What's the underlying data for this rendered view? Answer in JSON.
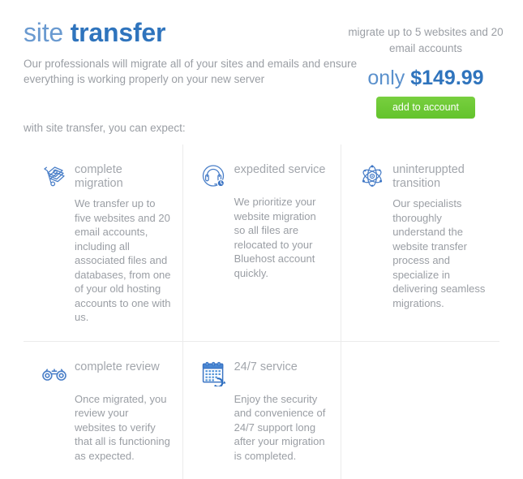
{
  "header": {
    "title_light": "site",
    "title_bold": "transfer",
    "subhead": "Our professionals will migrate all of your sites and emails and ensure everything is working properly on your new server",
    "offer_text": "migrate up to 5 websites and 20 email accounts",
    "price_prefix": "only",
    "price_amount": "$149.99",
    "cta_label": "add to account"
  },
  "expect_label": "with site transfer, you can expect:",
  "colors": {
    "title_light_blue": "#6a9ad0",
    "title_bold_blue": "#2f74bd",
    "body_gray": "#9a9ea4",
    "cta_green": "#63c32c",
    "divider": "#ebebeb",
    "icon_blue": "#3b74c4"
  },
  "features": [
    {
      "icon": "hand-truck-boxes-icon",
      "title": "complete migration",
      "body": "We transfer up to five websites and 20 email accounts, including all associated files and databases, from one of your old hosting accounts to one with us."
    },
    {
      "icon": "headset-clock-icon",
      "title": "expedited service",
      "body": "We prioritize your website migration so all files are relocated to your Bluehost account quickly."
    },
    {
      "icon": "atom-icon",
      "title": "uninteruppted transition",
      "body": "Our specialists thoroughly understand the website transfer process and specialize in delivering seamless migrations."
    },
    {
      "icon": "binoculars-icon",
      "title": "complete review",
      "body": "Once migrated, you review your websites to verify that all is functioning as expected."
    },
    {
      "icon": "calendar-refresh-icon",
      "title": "24/7 service",
      "body": "Enjoy the security and convenience of 24/7 support long after your migration is completed."
    }
  ]
}
